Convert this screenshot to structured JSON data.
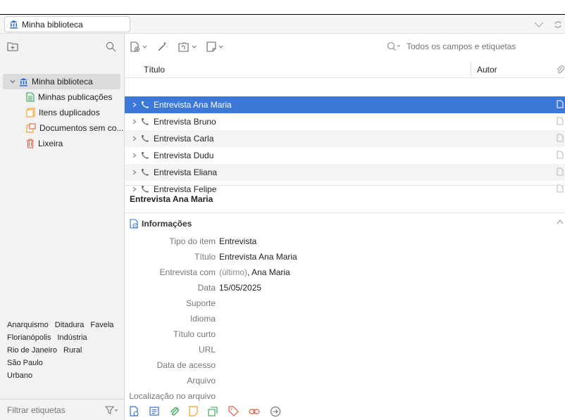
{
  "window": {
    "title": "Minha biblioteca"
  },
  "left": {
    "tree": [
      {
        "label": "Minha biblioteca",
        "icon": "library-icon",
        "type": "root"
      },
      {
        "label": "Minhas publicações",
        "icon": "publications-icon"
      },
      {
        "label": "Itens duplicados",
        "icon": "duplicates-icon"
      },
      {
        "label": "Documentos sem co...",
        "icon": "unfiled-icon"
      },
      {
        "label": "Lixeira",
        "icon": "trash-icon"
      }
    ],
    "tags": [
      "Anarquismo",
      "Ditadura",
      "Favela",
      "Florianópolis",
      "Indústria",
      "Rio de Janeiro",
      "Rural",
      "São Paulo",
      "Urbano"
    ],
    "filter_placeholder": "Filtrar etiquetas"
  },
  "search": {
    "placeholder": "Todos os campos e etiquetas"
  },
  "columns": {
    "title": "Título",
    "author": "Autor"
  },
  "items": [
    {
      "title": "Entrevista Ana Maria",
      "selected": true
    },
    {
      "title": "Entrevista Bruno"
    },
    {
      "title": "Entrevista Carla"
    },
    {
      "title": "Entrevista Dudu"
    },
    {
      "title": "Entrevista Eliana"
    },
    {
      "title": "Entrevista Felipe"
    }
  ],
  "detail": {
    "header": "Entrevista Ana Maria",
    "section": "Informações",
    "fields": [
      {
        "label": "Tipo do item",
        "value": "Entrevista"
      },
      {
        "label": "Título",
        "value": "Entrevista Ana Maria"
      },
      {
        "label": "Entrevista com",
        "prefix": "(último)",
        "value": ", Ana Maria"
      },
      {
        "label": "Data",
        "value": "15/05/2025"
      },
      {
        "label": "Suporte",
        "value": ""
      },
      {
        "label": "Idioma",
        "value": ""
      },
      {
        "label": "Título curto",
        "value": ""
      },
      {
        "label": "URL",
        "value": ""
      },
      {
        "label": "Data de acesso",
        "value": ""
      },
      {
        "label": "Arquivo",
        "value": ""
      },
      {
        "label": "Localização no arquivo",
        "value": ""
      }
    ]
  },
  "colors": {
    "selection": "#3b78d8",
    "accent_blue": "#2f6fd6",
    "library_icon": "#2a6fd8",
    "green_icon": "#2aa44f",
    "orange_icon": "#f0a020",
    "red_icon": "#e35a3c"
  }
}
